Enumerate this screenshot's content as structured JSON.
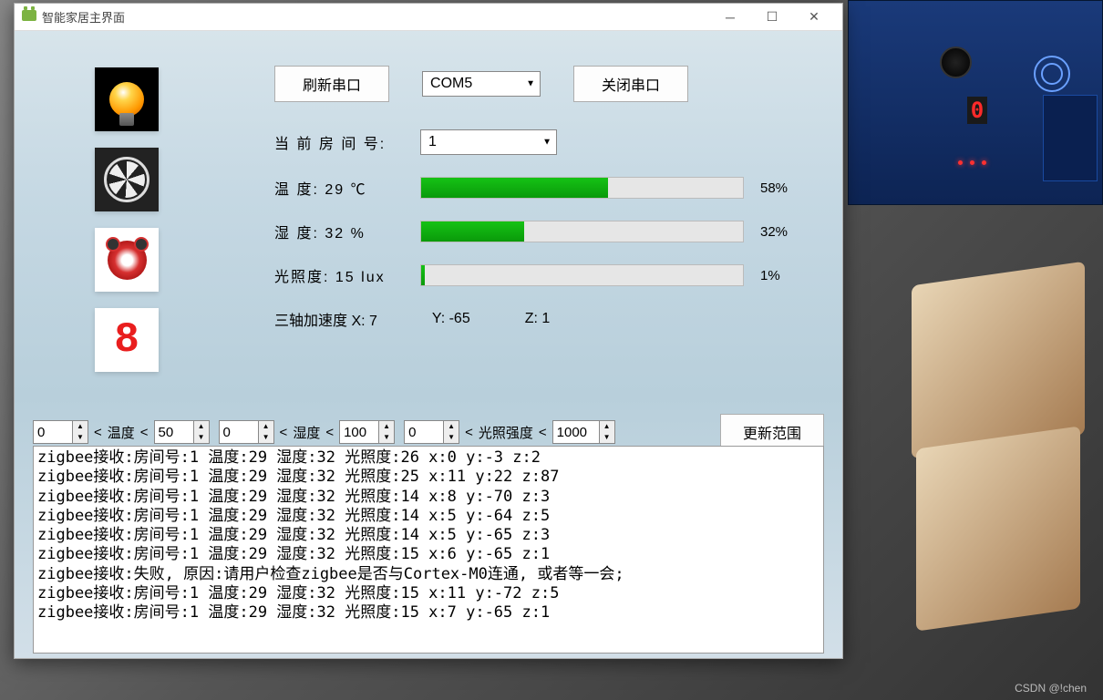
{
  "window": {
    "title": "智能家居主界面"
  },
  "toolbar": {
    "refresh_port_label": "刷新串口",
    "port_select_value": "COM5",
    "close_port_label": "关闭串口"
  },
  "room": {
    "label": "当 前 房 间 号:",
    "value": "1"
  },
  "sensors": {
    "temperature": {
      "label": "温  度: 29 ℃",
      "percent": "58%",
      "fill": 58
    },
    "humidity": {
      "label": "湿  度: 32 %",
      "percent": "32%",
      "fill": 32
    },
    "lux": {
      "label": "光照度: 15 lux",
      "percent": "1%",
      "fill": 1
    }
  },
  "accel": {
    "x_label": "三轴加速度 X: 7",
    "y_label": "Y: -65",
    "z_label": "Z: 1"
  },
  "range": {
    "temp_min": "0",
    "temp_label": "温度",
    "temp_max": "50",
    "hum_min": "0",
    "hum_label": "湿度",
    "hum_max": "100",
    "lux_min": "0",
    "lux_label": "光照强度",
    "lux_max": "1000",
    "lt": "<",
    "update_label": "更新范围"
  },
  "digit_display": "8",
  "log_lines": [
    "zigbee接收:房间号:1 温度:29 湿度:32 光照度:26 x:0 y:-3 z:2",
    "zigbee接收:房间号:1 温度:29 湿度:32 光照度:25 x:11 y:22 z:87",
    "zigbee接收:房间号:1 温度:29 湿度:32 光照度:14 x:8 y:-70 z:3",
    "zigbee接收:房间号:1 温度:29 湿度:32 光照度:14 x:5 y:-64 z:5",
    "zigbee接收:房间号:1 温度:29 湿度:32 光照度:14 x:5 y:-65 z:3",
    "zigbee接收:房间号:1 温度:29 湿度:32 光照度:15 x:6 y:-65 z:1",
    "zigbee接收:失败, 原因:请用户检查zigbee是否与Cortex-M0连通, 或者等一会;",
    "zigbee接收:房间号:1 温度:29 湿度:32 光照度:15 x:11 y:-72 z:5",
    "zigbee接收:房间号:1 温度:29 湿度:32 光照度:15 x:7 y:-65 z:1"
  ],
  "watermark": "CSDN @!chen"
}
